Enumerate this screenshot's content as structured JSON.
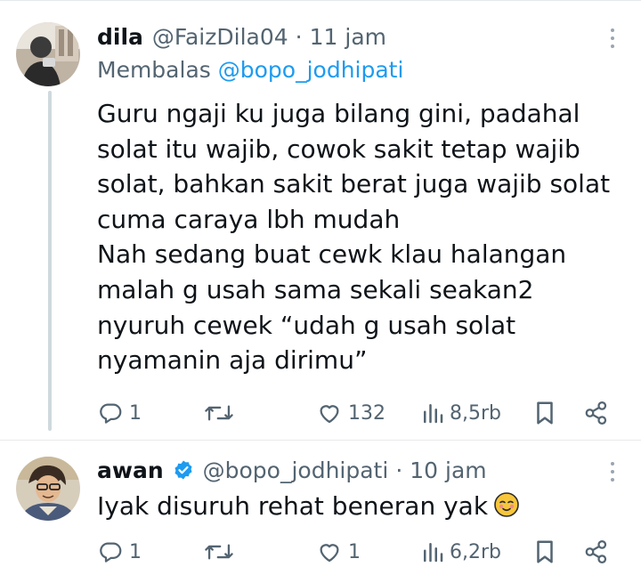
{
  "tweets": [
    {
      "name": "dila",
      "handle": "@FaizDila04",
      "separator": "·",
      "time": "11 jam",
      "replying_label": "Membalas",
      "replying_to": "@bopo_jodhipati",
      "body_lines": [
        "Guru ngaji ku juga bilang gini, padahal",
        "solat itu wajib, cowok sakit tetap wajib",
        "solat, bahkan sakit berat juga wajib solat",
        "cuma caraya lbh mudah",
        "Nah sedang buat cewk klau halangan",
        "malah g usah sama sekali seakan2",
        "nyuruh cewek “udah g usah solat",
        "nyamanin aja dirimu”"
      ],
      "actions": {
        "replies": "1",
        "retweets": "",
        "likes": "132",
        "views": "8,5rb"
      }
    },
    {
      "name": "awan",
      "handle": "@bopo_jodhipati",
      "separator": "·",
      "time": "10 jam",
      "body_lines": [
        "Iyak disuruh rehat beneran yak"
      ],
      "actions": {
        "replies": "1",
        "retweets": "",
        "likes": "1",
        "views": "6,2rb"
      }
    }
  ],
  "colors": {
    "accent": "#1d9bf0",
    "muted": "#536471",
    "text": "#0f1419",
    "thread_line": "#cfd9de"
  },
  "icons": [
    "reply-icon",
    "retweet-icon",
    "like-icon",
    "views-icon",
    "bookmark-icon",
    "share-icon",
    "verified-icon",
    "more-icon",
    "emoji-icon"
  ]
}
